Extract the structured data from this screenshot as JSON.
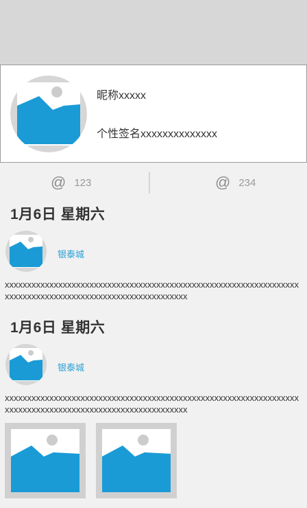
{
  "profile": {
    "nickname": "昵称xxxxx",
    "signature": "个性签名xxxxxxxxxxxxxx"
  },
  "stats": [
    {
      "icon": "at-icon",
      "value": "123"
    },
    {
      "icon": "at-icon",
      "value": "234"
    }
  ],
  "posts": [
    {
      "date": "1月6日  星期六",
      "author": "银泰城",
      "text": "xxxxxxxxxxxxxxxxxxxxxxxxxxxxxxxxxxxxxxxxxxxxxxxxxxxxxxxxxxxxxxxxxxxxxxxxxxxxxxxxxxxxxxxxxxxxxxxxxxxxxxxxxxx",
      "images": []
    },
    {
      "date": "1月6日  星期六",
      "author": "银泰城",
      "text": "xxxxxxxxxxxxxxxxxxxxxxxxxxxxxxxxxxxxxxxxxxxxxxxxxxxxxxxxxxxxxxxxxxxxxxxxxxxxxxxxxxxxxxxxxxxxxxxxxxxxxxxxxxx",
      "images": [
        "image-placeholder-icon",
        "image-placeholder-icon"
      ]
    }
  ],
  "colors": {
    "topbar": "#d7d7d7",
    "background": "#f1f1f1",
    "placeholder_blue": "#1a9bd6",
    "link": "#2aa0d6"
  }
}
